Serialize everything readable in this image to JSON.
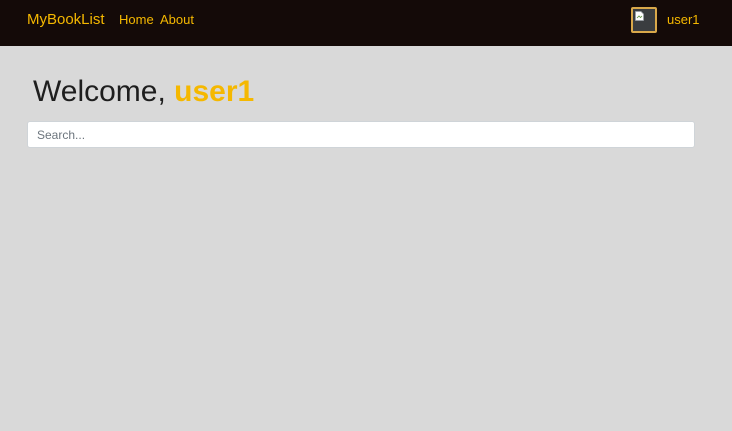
{
  "navbar": {
    "brand": "MyBookList",
    "links": [
      {
        "label": "Home"
      },
      {
        "label": "About"
      }
    ],
    "user": {
      "avatar_icon": "broken-image-icon",
      "username": "user1"
    }
  },
  "main": {
    "welcome_prefix": "Welcome, ",
    "welcome_name": "user1",
    "search": {
      "placeholder": "Search...",
      "value": ""
    }
  },
  "colors": {
    "navbar_bg": "#140a08",
    "accent": "#f5b800",
    "page_bg": "#d9d9d9"
  }
}
